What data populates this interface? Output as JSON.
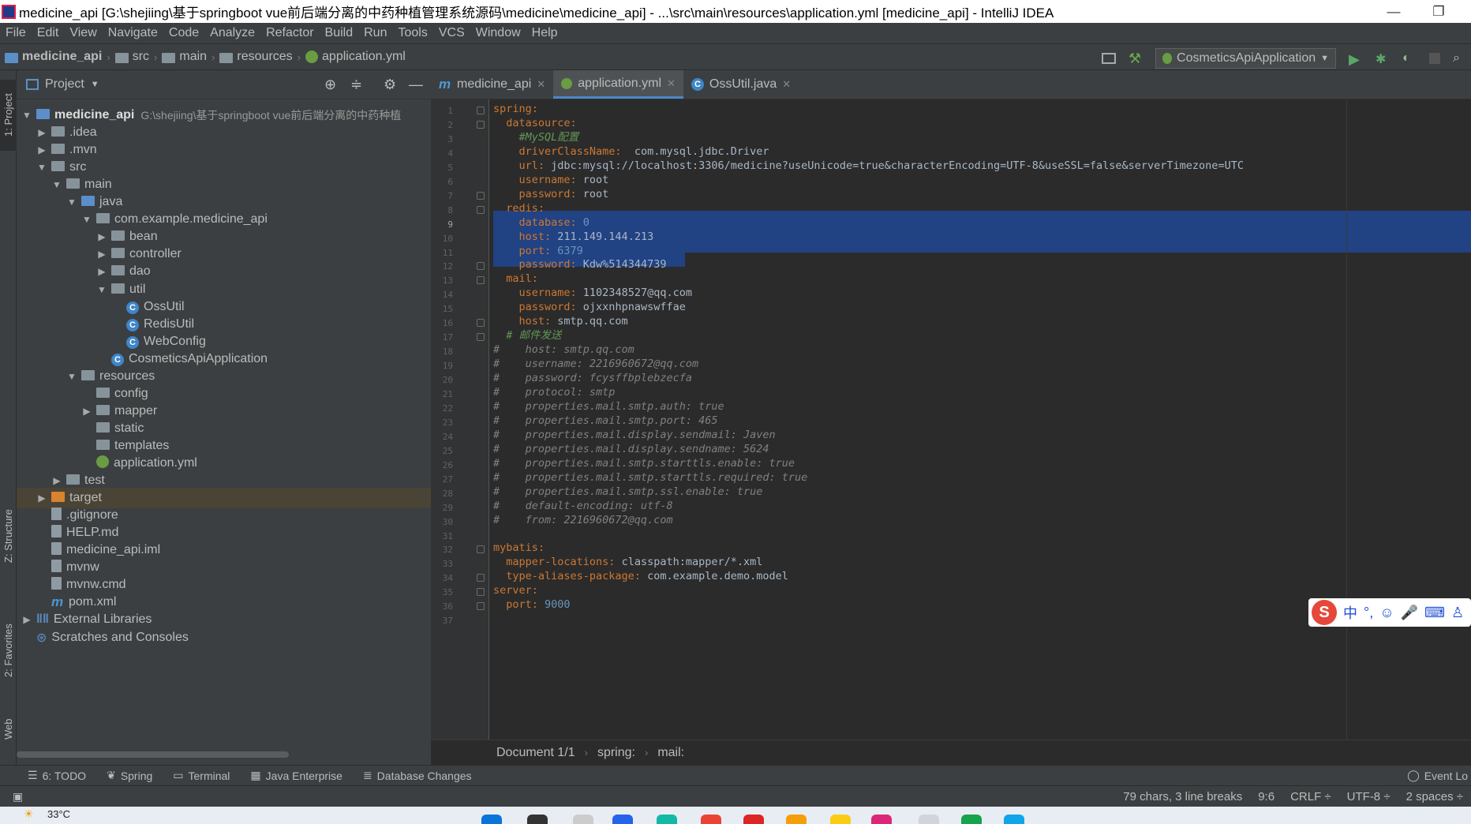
{
  "window": {
    "title": "medicine_api [G:\\shejiing\\基于springboot vue前后端分离的中药种植管理系统源码\\medicine\\medicine_api] - ...\\src\\main\\resources\\application.yml [medicine_api] - IntelliJ IDEA",
    "minimize": "—",
    "restore": "❐"
  },
  "menu": [
    "File",
    "Edit",
    "View",
    "Navigate",
    "Code",
    "Analyze",
    "Refactor",
    "Build",
    "Run",
    "Tools",
    "VCS",
    "Window",
    "Help"
  ],
  "breadcrumb": [
    "medicine_api",
    "src",
    "main",
    "resources",
    "application.yml"
  ],
  "run_config": "CosmeticsApiApplication",
  "project_panel": {
    "title": "Project",
    "side_tabs": {
      "project": "1: Project",
      "structure": "Z: Structure",
      "favorites": "2: Favorites",
      "web": "Web"
    },
    "root_path": "G:\\shejiing\\基于springboot vue前后端分离的中药种植",
    "tree": [
      {
        "label": "medicine_api",
        "depth": 0,
        "arrow": "▼",
        "icon": "module",
        "bold": true
      },
      {
        "label": ".idea",
        "depth": 1,
        "arrow": "▶",
        "icon": "folder"
      },
      {
        "label": ".mvn",
        "depth": 1,
        "arrow": "▶",
        "icon": "folder"
      },
      {
        "label": "src",
        "depth": 1,
        "arrow": "▼",
        "icon": "folder"
      },
      {
        "label": "main",
        "depth": 2,
        "arrow": "▼",
        "icon": "folder"
      },
      {
        "label": "java",
        "depth": 3,
        "arrow": "▼",
        "icon": "folder-blue"
      },
      {
        "label": "com.example.medicine_api",
        "depth": 4,
        "arrow": "▼",
        "icon": "folder"
      },
      {
        "label": "bean",
        "depth": 5,
        "arrow": "▶",
        "icon": "folder"
      },
      {
        "label": "controller",
        "depth": 5,
        "arrow": "▶",
        "icon": "folder"
      },
      {
        "label": "dao",
        "depth": 5,
        "arrow": "▶",
        "icon": "folder"
      },
      {
        "label": "util",
        "depth": 5,
        "arrow": "▼",
        "icon": "folder"
      },
      {
        "label": "OssUtil",
        "depth": 6,
        "arrow": "",
        "icon": "class"
      },
      {
        "label": "RedisUtil",
        "depth": 6,
        "arrow": "",
        "icon": "class"
      },
      {
        "label": "WebConfig",
        "depth": 6,
        "arrow": "",
        "icon": "class"
      },
      {
        "label": "CosmeticsApiApplication",
        "depth": 5,
        "arrow": "",
        "icon": "class"
      },
      {
        "label": "resources",
        "depth": 3,
        "arrow": "▼",
        "icon": "folder"
      },
      {
        "label": "config",
        "depth": 4,
        "arrow": "",
        "icon": "folder"
      },
      {
        "label": "mapper",
        "depth": 4,
        "arrow": "▶",
        "icon": "folder"
      },
      {
        "label": "static",
        "depth": 4,
        "arrow": "",
        "icon": "folder"
      },
      {
        "label": "templates",
        "depth": 4,
        "arrow": "",
        "icon": "folder"
      },
      {
        "label": "application.yml",
        "depth": 4,
        "arrow": "",
        "icon": "yml"
      },
      {
        "label": "test",
        "depth": 2,
        "arrow": "▶",
        "icon": "folder"
      },
      {
        "label": "target",
        "depth": 1,
        "arrow": "▶",
        "icon": "folder-orange",
        "highlight": true
      },
      {
        "label": ".gitignore",
        "depth": 1,
        "arrow": "",
        "icon": "file"
      },
      {
        "label": "HELP.md",
        "depth": 1,
        "arrow": "",
        "icon": "file"
      },
      {
        "label": "medicine_api.iml",
        "depth": 1,
        "arrow": "",
        "icon": "file"
      },
      {
        "label": "mvnw",
        "depth": 1,
        "arrow": "",
        "icon": "file"
      },
      {
        "label": "mvnw.cmd",
        "depth": 1,
        "arrow": "",
        "icon": "file"
      },
      {
        "label": "pom.xml",
        "depth": 1,
        "arrow": "",
        "icon": "maven"
      },
      {
        "label": "External Libraries",
        "depth": 0,
        "arrow": "▶",
        "icon": "lib"
      },
      {
        "label": "Scratches and Consoles",
        "depth": 0,
        "arrow": "",
        "icon": "scratch"
      }
    ]
  },
  "tabs": [
    {
      "label": "medicine_api",
      "icon": "maven-icon",
      "active": false
    },
    {
      "label": "application.yml",
      "icon": "yml-icon",
      "active": true
    },
    {
      "label": "OssUtil.java",
      "icon": "class-icon",
      "active": false
    }
  ],
  "code_lines": [
    [
      [
        "k",
        "spring:"
      ]
    ],
    [
      [
        "k",
        "  datasource:"
      ]
    ],
    [
      [
        "c",
        "    #MySQL配置"
      ]
    ],
    [
      [
        "k",
        "    driverClassName:"
      ],
      [
        "v",
        "  com.mysql.jdbc.Driver"
      ]
    ],
    [
      [
        "k",
        "    url:"
      ],
      [
        "v",
        " jdbc:mysql://localhost:3306/medicine?useUnicode=true&characterEncoding=UTF-8&useSSL=false&serverTimezone=UTC"
      ]
    ],
    [
      [
        "k",
        "    username:"
      ],
      [
        "v",
        " root"
      ]
    ],
    [
      [
        "k",
        "    password:"
      ],
      [
        "v",
        " root"
      ]
    ],
    [
      [
        "k",
        "  redis:"
      ]
    ],
    [
      [
        "k",
        "    database:"
      ],
      [
        "n",
        " 0"
      ]
    ],
    [
      [
        "k",
        "    host:"
      ],
      [
        "v",
        " 211.149.144.213"
      ]
    ],
    [
      [
        "k",
        "    port:"
      ],
      [
        "n",
        " 6379"
      ]
    ],
    [
      [
        "k",
        "    password:"
      ],
      [
        "v",
        " Kdw%514344739"
      ]
    ],
    [
      [
        "k",
        "  mail:"
      ]
    ],
    [
      [
        "k",
        "    username:"
      ],
      [
        "v",
        " 1102348527@qq.com"
      ]
    ],
    [
      [
        "k",
        "    password:"
      ],
      [
        "v",
        " ojxxnhpnawswffae"
      ]
    ],
    [
      [
        "k",
        "    host:"
      ],
      [
        "v",
        " smtp.qq.com"
      ]
    ],
    [
      [
        "c",
        "  # 邮件发送"
      ]
    ],
    [
      [
        "cm",
        "#    host: smtp.qq.com"
      ]
    ],
    [
      [
        "cm",
        "#    username: 2216960672@qq.com"
      ]
    ],
    [
      [
        "cm",
        "#    password: fcysffbplebzecfa"
      ]
    ],
    [
      [
        "cm",
        "#    protocol: smtp"
      ]
    ],
    [
      [
        "cm",
        "#    properties.mail.smtp.auth: true"
      ]
    ],
    [
      [
        "cm",
        "#    properties.mail.smtp.port: 465"
      ]
    ],
    [
      [
        "cm",
        "#    properties.mail.display.sendmail: Javen"
      ]
    ],
    [
      [
        "cm",
        "#    properties.mail.display.sendname: 5624"
      ]
    ],
    [
      [
        "cm",
        "#    properties.mail.smtp.starttls.enable: true"
      ]
    ],
    [
      [
        "cm",
        "#    properties.mail.smtp.starttls.required: true"
      ]
    ],
    [
      [
        "cm",
        "#    properties.mail.smtp.ssl.enable: true"
      ]
    ],
    [
      [
        "cm",
        "#    default-encoding: utf-8"
      ]
    ],
    [
      [
        "cm",
        "#    from: 2216960672@qq.com"
      ]
    ],
    [],
    [
      [
        "k",
        "mybatis:"
      ]
    ],
    [
      [
        "k",
        "  mapper-locations:"
      ],
      [
        "v",
        " classpath:mapper/*.xml"
      ]
    ],
    [
      [
        "k",
        "  type-aliases-package:"
      ],
      [
        "v",
        " com.example.demo.model"
      ]
    ],
    [
      [
        "k",
        "server:"
      ]
    ],
    [
      [
        "k",
        "  port:"
      ],
      [
        "n",
        " 9000"
      ]
    ],
    []
  ],
  "editor_breadcrumb": [
    "Document 1/1",
    "spring:",
    "mail:"
  ],
  "toolwindows": [
    {
      "label": "6: TODO",
      "icon": "todo-icon"
    },
    {
      "label": "Spring",
      "icon": "spring-icon"
    },
    {
      "label": "Terminal",
      "icon": "terminal-icon"
    },
    {
      "label": "Java Enterprise",
      "icon": "java-enterprise-icon"
    },
    {
      "label": "Database Changes",
      "icon": "database-icon"
    }
  ],
  "event_log": "Event Lo",
  "status": {
    "selection": "79 chars, 3 line breaks",
    "position": "9:6",
    "line_sep": "CRLF ÷",
    "encoding": "UTF-8 ÷",
    "indent": "2 spaces ÷"
  },
  "ime": {
    "lang": "中",
    "punct": "°,"
  },
  "taskbar": {
    "weather": "33°C"
  }
}
